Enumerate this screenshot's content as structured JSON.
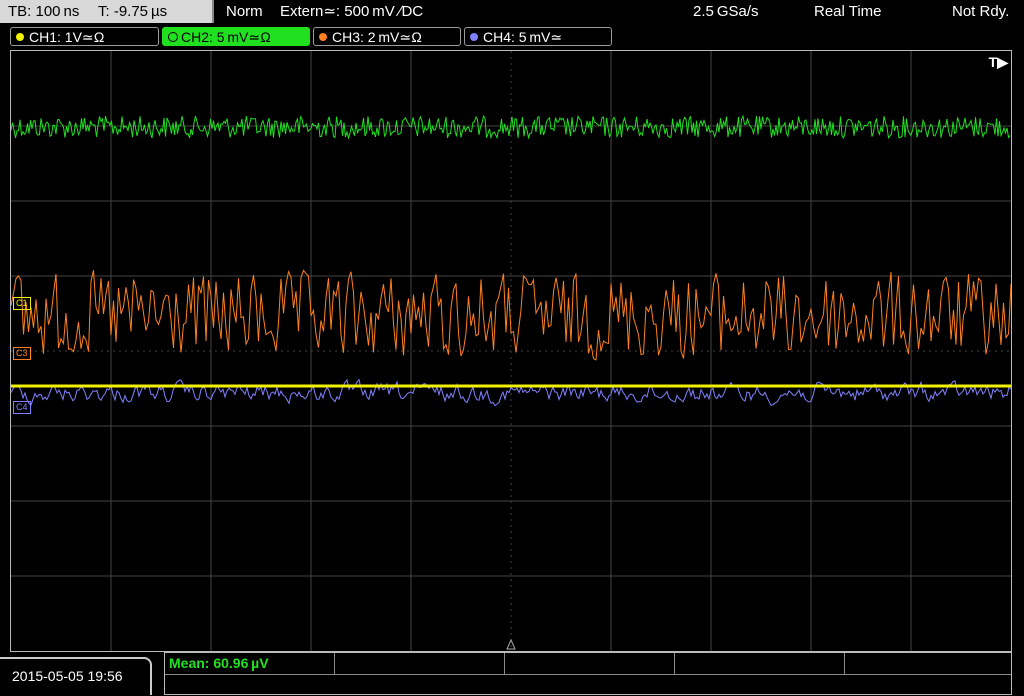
{
  "header": {
    "timebase": "TB: 100 ns",
    "trigger_time": "T: -9.75 µs",
    "mode": "Norm",
    "trigger_source": "Extern≃: 500 mV ∕DC",
    "sample_rate": "2.5 GSa/s",
    "acq_mode": "Real Time",
    "status": "Not Rdy."
  },
  "channels": [
    {
      "label": "CH1: 1V≃Ω",
      "color": "#f0f000"
    },
    {
      "label": "CH2: 5 mV≃Ω",
      "color": "#20e020",
      "active": true
    },
    {
      "label": "CH3: 2 mV≃Ω",
      "color": "#ff8020"
    },
    {
      "label": "CH4: 5 mV≃",
      "color": "#8080ff"
    }
  ],
  "markers": {
    "c1": "C1",
    "c3": "C3",
    "c4": "C4",
    "trigger": "T▶"
  },
  "colors": {
    "ch1": "#f0f000",
    "ch2": "#20e020",
    "ch3": "#ff8020",
    "ch4": "#8080ff",
    "grid": "#555555"
  },
  "footer": {
    "datetime": "2015-05-05 19:56",
    "measurement": "Mean: 60.96 µV"
  }
}
